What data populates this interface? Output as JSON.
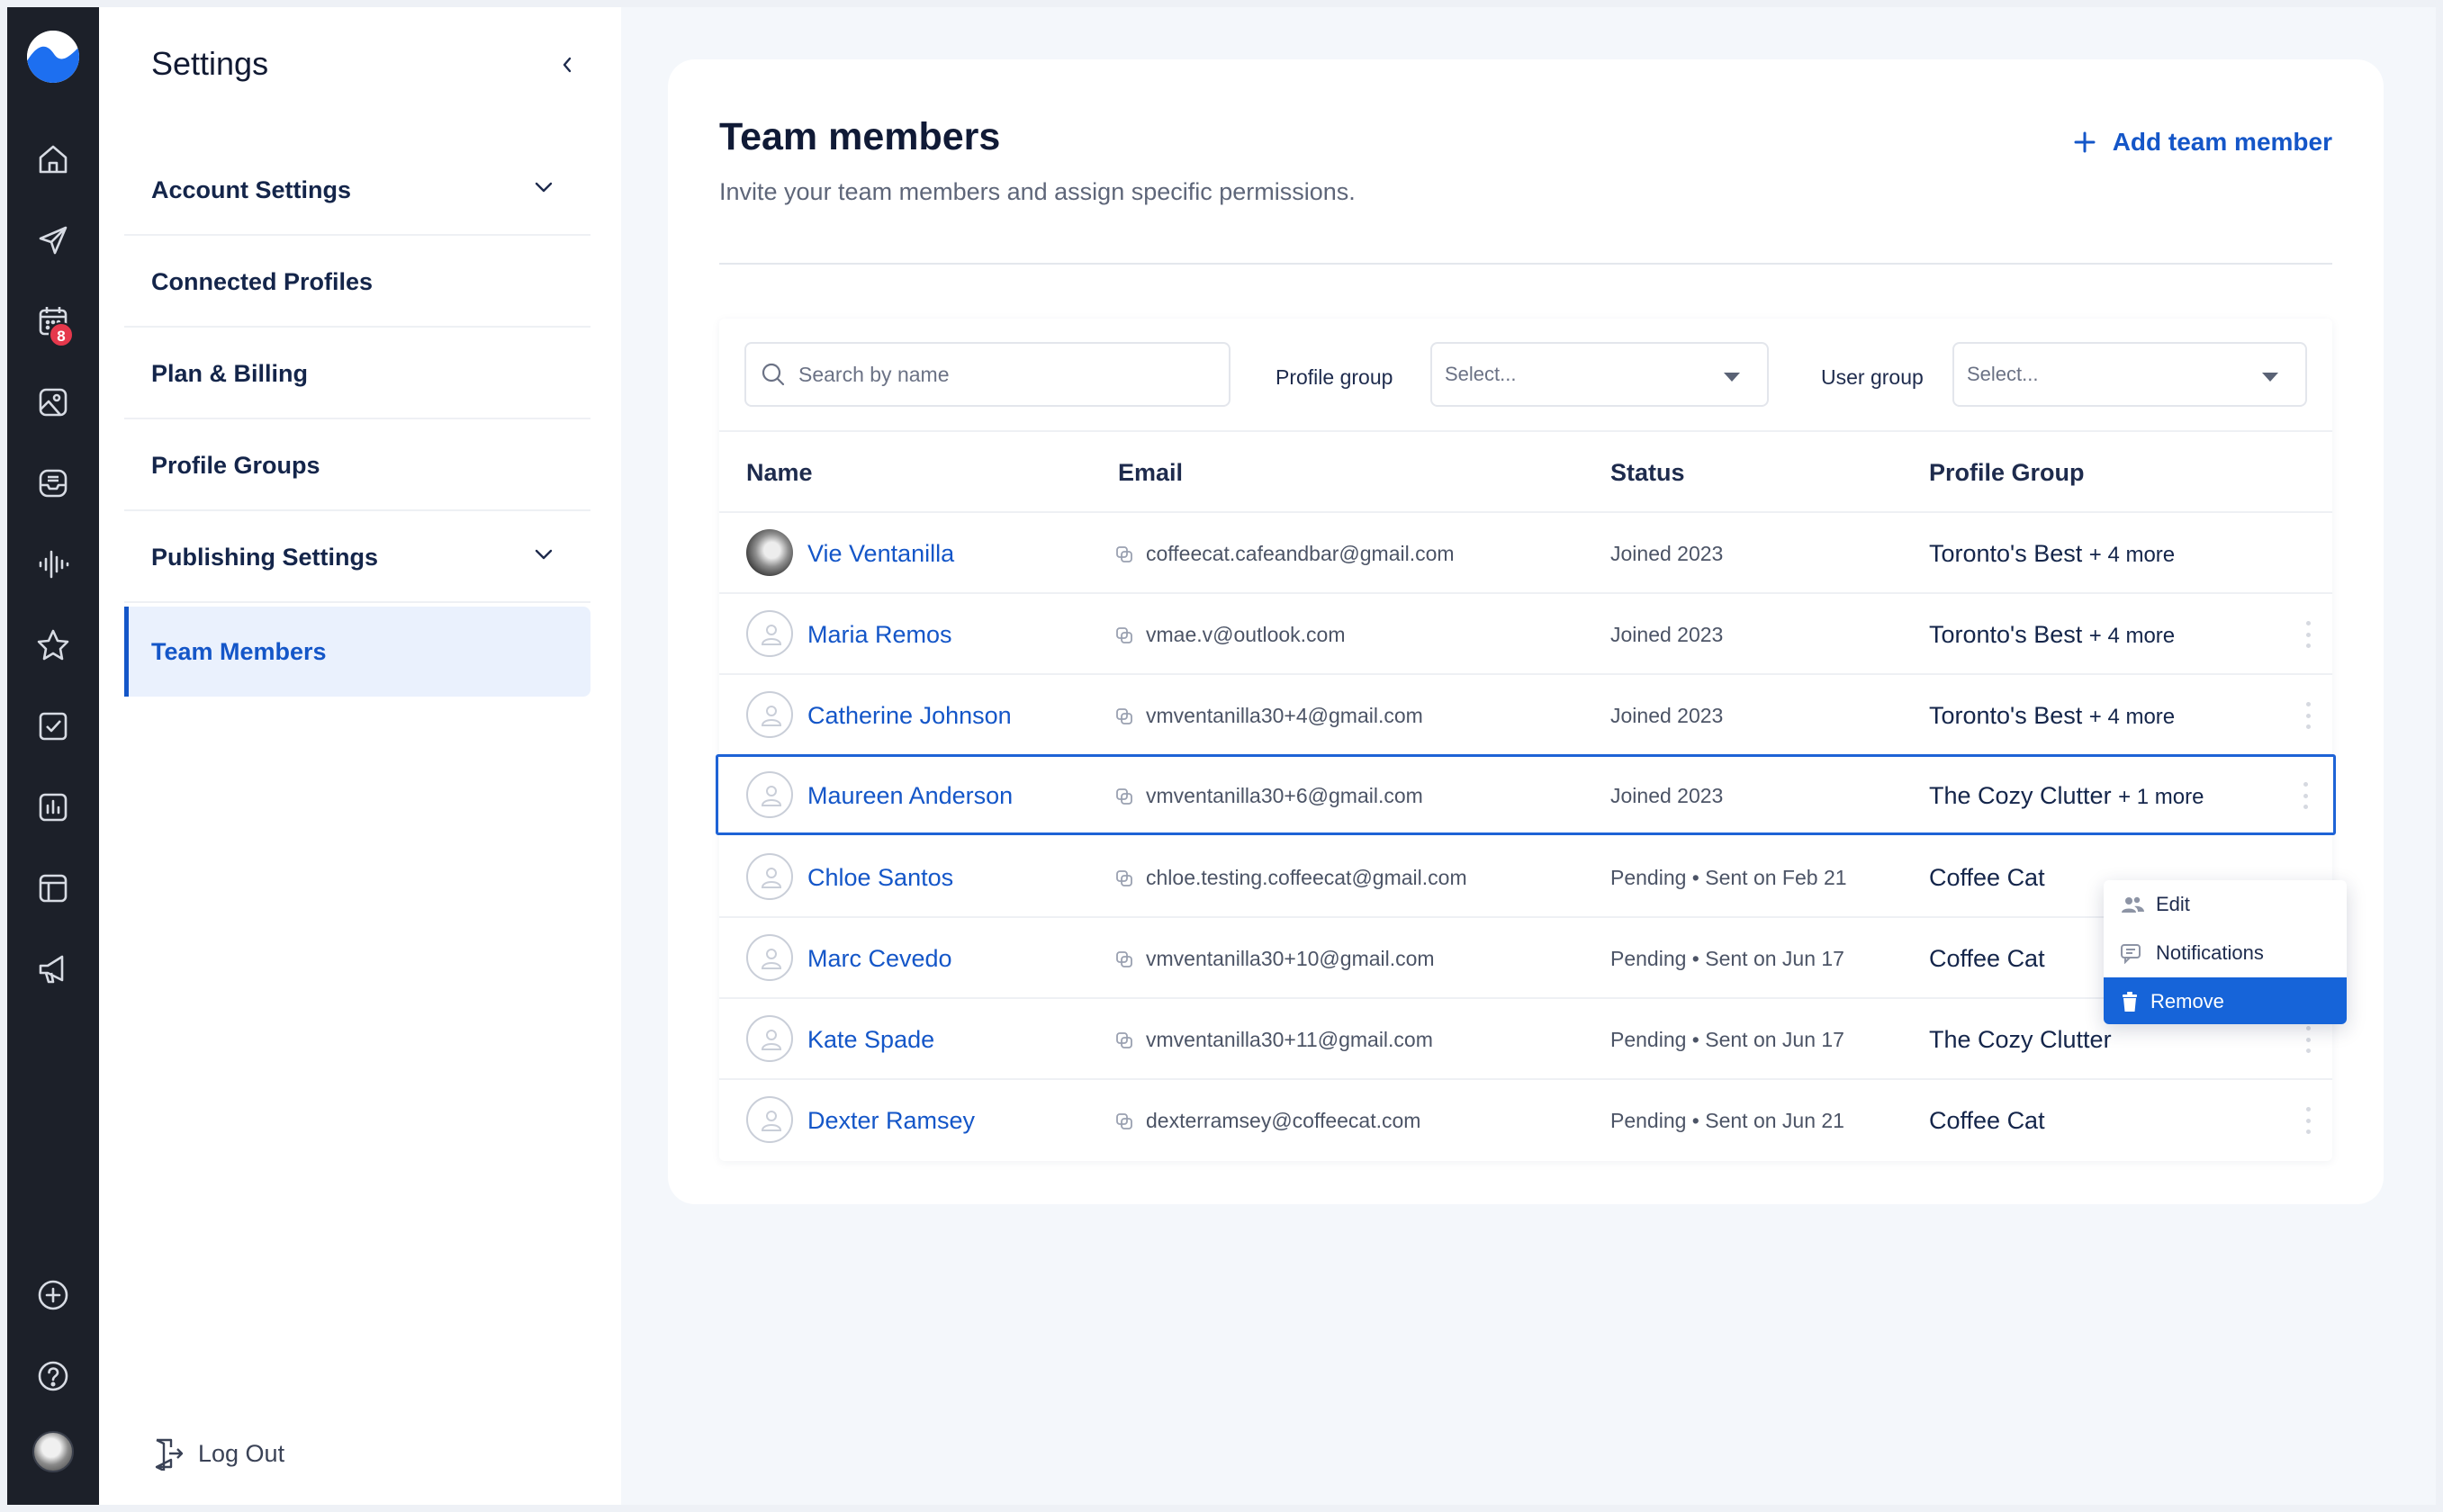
{
  "rail": {
    "badge_count": "8",
    "items": [
      "home-icon",
      "send-icon",
      "calendar-icon",
      "media-icon",
      "inbox-icon",
      "listening-icon",
      "star-icon",
      "tasks-icon",
      "analytics-icon",
      "layout-icon",
      "megaphone-icon"
    ],
    "bottom_items": [
      "add-icon",
      "help-icon"
    ]
  },
  "sidebar": {
    "title": "Settings",
    "items": [
      {
        "label": "Account Settings"
      },
      {
        "label": "Connected Profiles"
      },
      {
        "label": "Plan & Billing"
      },
      {
        "label": "Profile Groups"
      },
      {
        "label": "Publishing Settings"
      },
      {
        "label": "Team Members"
      }
    ],
    "logout_label": "Log Out"
  },
  "main": {
    "title": "Team members",
    "subtitle": "Invite your team members and assign specific permissions.",
    "add_label": "Add team member",
    "search_placeholder": "Search by name",
    "profile_group_label": "Profile group",
    "profile_group_value": "Select...",
    "user_group_label": "User group",
    "user_group_value": "Select...",
    "columns": {
      "name": "Name",
      "email": "Email",
      "status": "Status",
      "group": "Profile Group"
    },
    "rows": [
      {
        "name": "Vie Ventanilla",
        "email": "coffeecat.cafeandbar@gmail.com",
        "status": "Joined 2023",
        "group": "Toronto's Best",
        "more": "+ 4 more"
      },
      {
        "name": "Maria Remos",
        "email": "vmae.v@outlook.com",
        "status": "Joined 2023",
        "group": "Toronto's Best",
        "more": "+ 4 more"
      },
      {
        "name": "Catherine Johnson",
        "email": "vmventanilla30+4@gmail.com",
        "status": "Joined 2023",
        "group": "Toronto's Best",
        "more": "+ 4 more"
      },
      {
        "name": "Maureen Anderson",
        "email": "vmventanilla30+6@gmail.com",
        "status": "Joined 2023",
        "group": "The Cozy Clutter",
        "more": "+ 1 more"
      },
      {
        "name": "Chloe Santos",
        "email": "chloe.testing.coffeecat@gmail.com",
        "status": "Pending • Sent on Feb 21",
        "group": "Coffee Cat",
        "more": ""
      },
      {
        "name": "Marc Cevedo",
        "email": "vmventanilla30+10@gmail.com",
        "status": "Pending • Sent on Jun 17",
        "group": "Coffee Cat",
        "more": ""
      },
      {
        "name": "Kate Spade",
        "email": "vmventanilla30+11@gmail.com",
        "status": "Pending • Sent on Jun 17",
        "group": "The Cozy Clutter",
        "more": ""
      },
      {
        "name": "Dexter Ramsey",
        "email": "dexterramsey@coffeecat.com",
        "status": "Pending • Sent on Jun 21",
        "group": "Coffee Cat",
        "more": ""
      }
    ],
    "menu": {
      "edit": "Edit",
      "notifications": "Notifications",
      "remove": "Remove"
    }
  },
  "colors": {
    "accent": "#1456c8",
    "rail": "#1c2029",
    "danger_badge": "#e5384c",
    "menu_highlight": "#1664d9"
  }
}
